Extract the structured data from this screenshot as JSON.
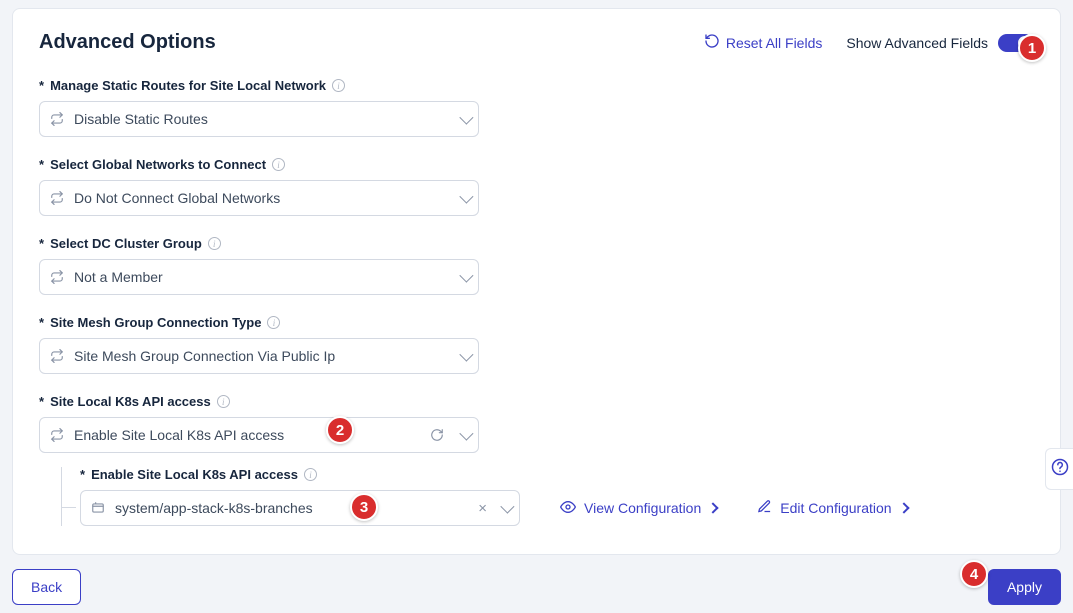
{
  "header": {
    "title": "Advanced Options",
    "reset_label": "Reset All Fields",
    "show_advanced_label": "Show Advanced Fields"
  },
  "fields": {
    "routes": {
      "label": "Manage Static Routes for Site Local Network",
      "value": "Disable Static Routes"
    },
    "globalnw": {
      "label": "Select Global Networks to Connect",
      "value": "Do Not Connect Global Networks"
    },
    "dcgroup": {
      "label": "Select DC Cluster Group",
      "value": "Not a Member"
    },
    "mesh": {
      "label": "Site Mesh Group Connection Type",
      "value": "Site Mesh Group Connection Via Public Ip"
    },
    "k8s": {
      "label": "Site Local K8s API access",
      "value": "Enable Site Local K8s API access"
    },
    "k8s_sub": {
      "label": "Enable Site Local K8s API access",
      "value": "system/app-stack-k8s-branches"
    }
  },
  "actions": {
    "view_cfg": "View Configuration",
    "edit_cfg": "Edit Configuration"
  },
  "footer": {
    "back": "Back",
    "apply": "Apply"
  },
  "badges": {
    "b1": "1",
    "b2": "2",
    "b3": "3",
    "b4": "4"
  },
  "help": "?"
}
